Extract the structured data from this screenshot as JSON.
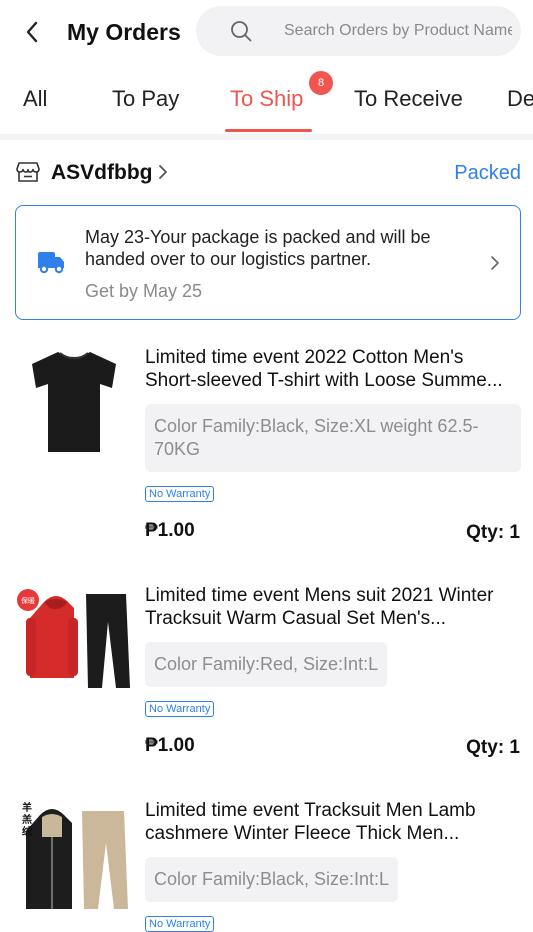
{
  "header": {
    "title": "My Orders",
    "search_placeholder": "Search Orders by Product Name"
  },
  "tabs": [
    {
      "label": "All"
    },
    {
      "label": "To Pay"
    },
    {
      "label": "To Ship",
      "badge": "8",
      "active": true
    },
    {
      "label": "To Receive"
    },
    {
      "label": "De"
    }
  ],
  "shop": {
    "name": "ASVdfbbg",
    "status": "Packed"
  },
  "delivery": {
    "message": "May 23-Your package is packed and will be handed over to our logistics partner.",
    "eta": "Get by May 25"
  },
  "items": [
    {
      "title_line1": "Limited time event 2022 Cotton Men's",
      "title_line2": "Short-sleeved T-shirt with Loose Summe...",
      "variant": "Color Family:Black, Size:XL weight 62.5-70KG",
      "warranty": "No Warranty",
      "price": "₱1.00",
      "qty": "Qty: 1",
      "thumb": "black-tshirt"
    },
    {
      "title_line1": "Limited time event Mens suit 2021 Winter",
      "title_line2": "Tracksuit Warm Casual Set Men's...",
      "variant": "Color Family:Red, Size:Int:L",
      "warranty": "No Warranty",
      "price": "₱1.00",
      "qty": "Qty: 1",
      "thumb": "red-tracksuit"
    },
    {
      "title_line1": "Limited time event Tracksuit Men Lamb",
      "title_line2": "cashmere Winter Fleece Thick Men...",
      "variant": "Color Family:Black, Size:Int:L",
      "warranty": "No Warranty",
      "thumb": "black-fleece-tracksuit"
    }
  ],
  "colors": {
    "accent": "#f0554f",
    "link": "#2f80ed"
  }
}
